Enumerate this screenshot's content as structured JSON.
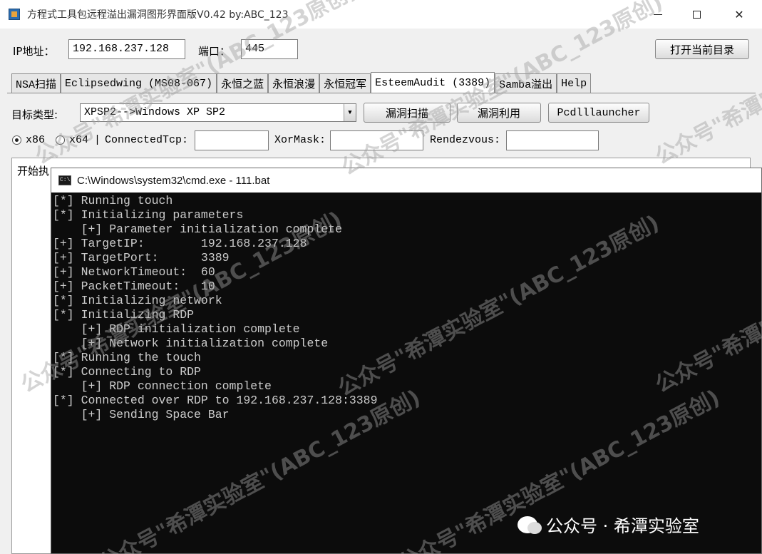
{
  "window": {
    "title": "方程式工具包远程溢出漏洞图形界面版V0.42 by:ABC_123"
  },
  "connection": {
    "ip_label": "IP地址：",
    "ip_value": "192.168.237.128",
    "port_label": "端口：",
    "port_value": "445",
    "open_dir_button": "打开当前目录"
  },
  "tabs": [
    {
      "label": "NSA扫描",
      "active": false
    },
    {
      "label": "Eclipsedwing (MS08-067)",
      "active": false
    },
    {
      "label": "永恒之蓝",
      "active": false
    },
    {
      "label": "永恒浪漫",
      "active": false
    },
    {
      "label": "永恒冠军",
      "active": false
    },
    {
      "label": "EsteemAudit (3389)",
      "active": true
    },
    {
      "label": "Samba溢出",
      "active": false
    },
    {
      "label": "Help",
      "active": false
    }
  ],
  "target": {
    "label": "目标类型:",
    "selected": "XPSP2-->Windows XP SP2",
    "scan_button": "漏洞扫描",
    "exploit_button": "漏洞利用",
    "pcdll_button": "Pcdlllauncher"
  },
  "options": {
    "x86_label": "x86",
    "x64_label": "x64",
    "x86_selected": true,
    "separator": "|",
    "connected_tcp_label": "ConnectedTcp:",
    "connected_tcp_value": "",
    "xormask_label": "XorMask:",
    "xormask_value": "",
    "rendezvous_label": "Rendezvous:",
    "rendezvous_value": ""
  },
  "output": {
    "visible_text": "开始执"
  },
  "cmd": {
    "title": "C:\\Windows\\system32\\cmd.exe - 111.bat",
    "icon_text": "C:\\",
    "lines": [
      "[*] Running touch",
      "[*] Initializing parameters",
      "    [+] Parameter initialization complete",
      "[+] TargetIP:        192.168.237.128",
      "[+] TargetPort:      3389",
      "[+] NetworkTimeout:  60",
      "[+] PacketTimeout:   10",
      "[*] Initializing network",
      "[*] Initializing RDP",
      "    [+] RDP initialization complete",
      "    [+] Network initialization complete",
      "[*] Running the touch",
      "[*] Connecting to RDP",
      "    [+] RDP connection complete",
      "[*] Connected over RDP to 192.168.237.128:3389",
      "    [+] Sending Space Bar"
    ]
  },
  "watermark": {
    "text": "公众号\"希潭实验室\"(ABC_123原创)",
    "brand": "公众号 · 希潭实验室"
  }
}
